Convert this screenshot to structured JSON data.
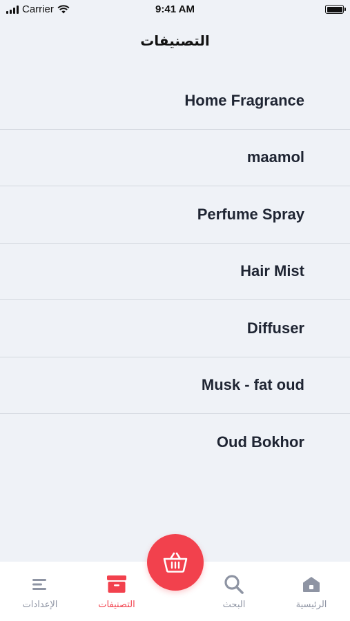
{
  "status_bar": {
    "carrier": "Carrier",
    "time": "9:41 AM"
  },
  "header": {
    "title": "التصنيفات"
  },
  "categories": [
    "Home Fragrance",
    "maamol",
    "Perfume Spray",
    "Hair Mist",
    "Diffuser",
    "Musk - fat oud",
    "Oud Bokhor"
  ],
  "tab_bar": {
    "settings_label": "الإعدادات",
    "categories_label": "التصنيفات",
    "search_label": "البحث",
    "home_label": "الرئيسية",
    "active_tab": "categories"
  },
  "colors": {
    "accent": "#f2414d",
    "background": "#eff2f7",
    "text": "#1f2533",
    "inactive": "#8e94a3"
  }
}
